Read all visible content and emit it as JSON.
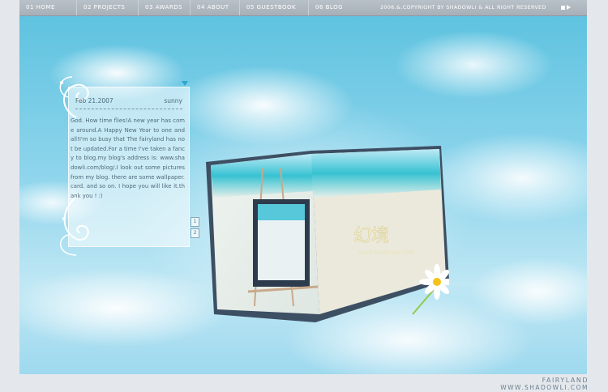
{
  "nav": {
    "items": [
      {
        "label": "01  HOME"
      },
      {
        "label": "02  PROJECTS"
      },
      {
        "label": "03 AWARDS"
      },
      {
        "label": "04  ABOUT"
      },
      {
        "label": "05  GUESTBOOK"
      },
      {
        "label": "06  BLOG"
      }
    ],
    "copyright": "2006.&.COPYRIGHT BY SHADOWLI & ALL RIGHT RESERVED"
  },
  "post": {
    "date": "Feb 21.2007",
    "weather": "sunny",
    "body": "God. How time flies!A new year has come around.A Happy New Year to one and all!I'm so busy that The fairyland has not be updated.For a time I've taken a fancy to blog.my blog's address is: www.shadowli.com/blog/.I look out some pictures from my blog. there are some wallpaper.card. and so on. I hope you will like it.thank you ! :)",
    "pages": [
      "1",
      "2"
    ]
  },
  "book": {
    "logo_text": "幻境",
    "logo_url": "WWW.SHADOWLI.COM"
  },
  "footer": {
    "title": "FAIRYLAND",
    "url": "WWW.SHADOWLI.COM"
  },
  "colors": {
    "topbar": "#b0b8c0",
    "sky": "#8fd5ec",
    "text": "#4f6a7a",
    "accent": "#2aa6cf"
  }
}
